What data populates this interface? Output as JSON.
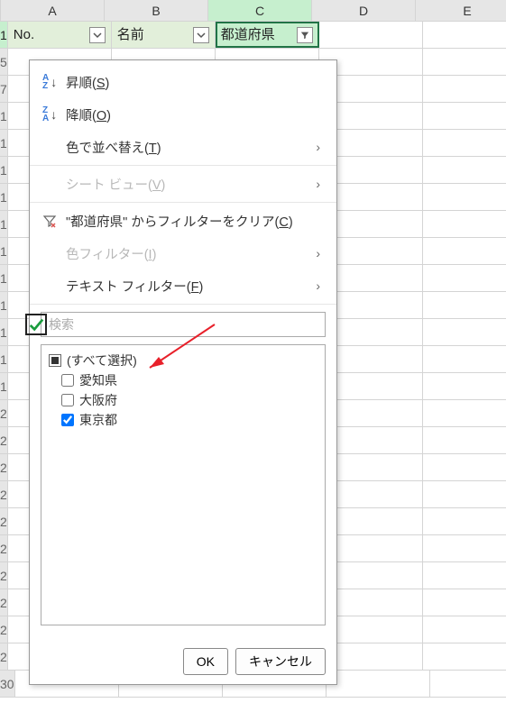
{
  "columns": [
    "A",
    "B",
    "C",
    "D",
    "E"
  ],
  "headers": {
    "no": "No.",
    "name": "名前",
    "pref": "都道府県"
  },
  "visibleRowNums": [
    "1",
    "5",
    "7",
    "1",
    "1",
    "1",
    "1",
    "1",
    "1",
    "1",
    "1",
    "1",
    "1",
    "1",
    "2",
    "2",
    "2",
    "2",
    "2",
    "2",
    "2",
    "2",
    "2",
    "2",
    "30"
  ],
  "menu": {
    "sortAsc": "昇順(",
    "sortAscKey": "S",
    "sortAscEnd": ")",
    "sortDesc": "降順(",
    "sortDescKey": "O",
    "sortDescEnd": ")",
    "sortByColor": "色で並べ替え(",
    "sortByColorKey": "T",
    "sortByColorEnd": ")",
    "sheetView": "シート ビュー(",
    "sheetViewKey": "V",
    "sheetViewEnd": ")",
    "clearFilter1": "\"都道府県\" からフィルターをクリア(",
    "clearFilterKey": "C",
    "clearFilterEnd": ")",
    "colorFilter": "色フィルター(",
    "colorFilterKey": "I",
    "colorFilterEnd": ")",
    "textFilter": "テキスト フィルター(",
    "textFilterKey": "F",
    "textFilterEnd": ")",
    "searchPlaceholder": "検索",
    "selectAll": "(すべて選択)",
    "items": [
      {
        "label": "愛知県",
        "checked": false
      },
      {
        "label": "大阪府",
        "checked": false
      },
      {
        "label": "東京都",
        "checked": true
      }
    ],
    "ok": "OK",
    "cancel": "キャンセル"
  }
}
